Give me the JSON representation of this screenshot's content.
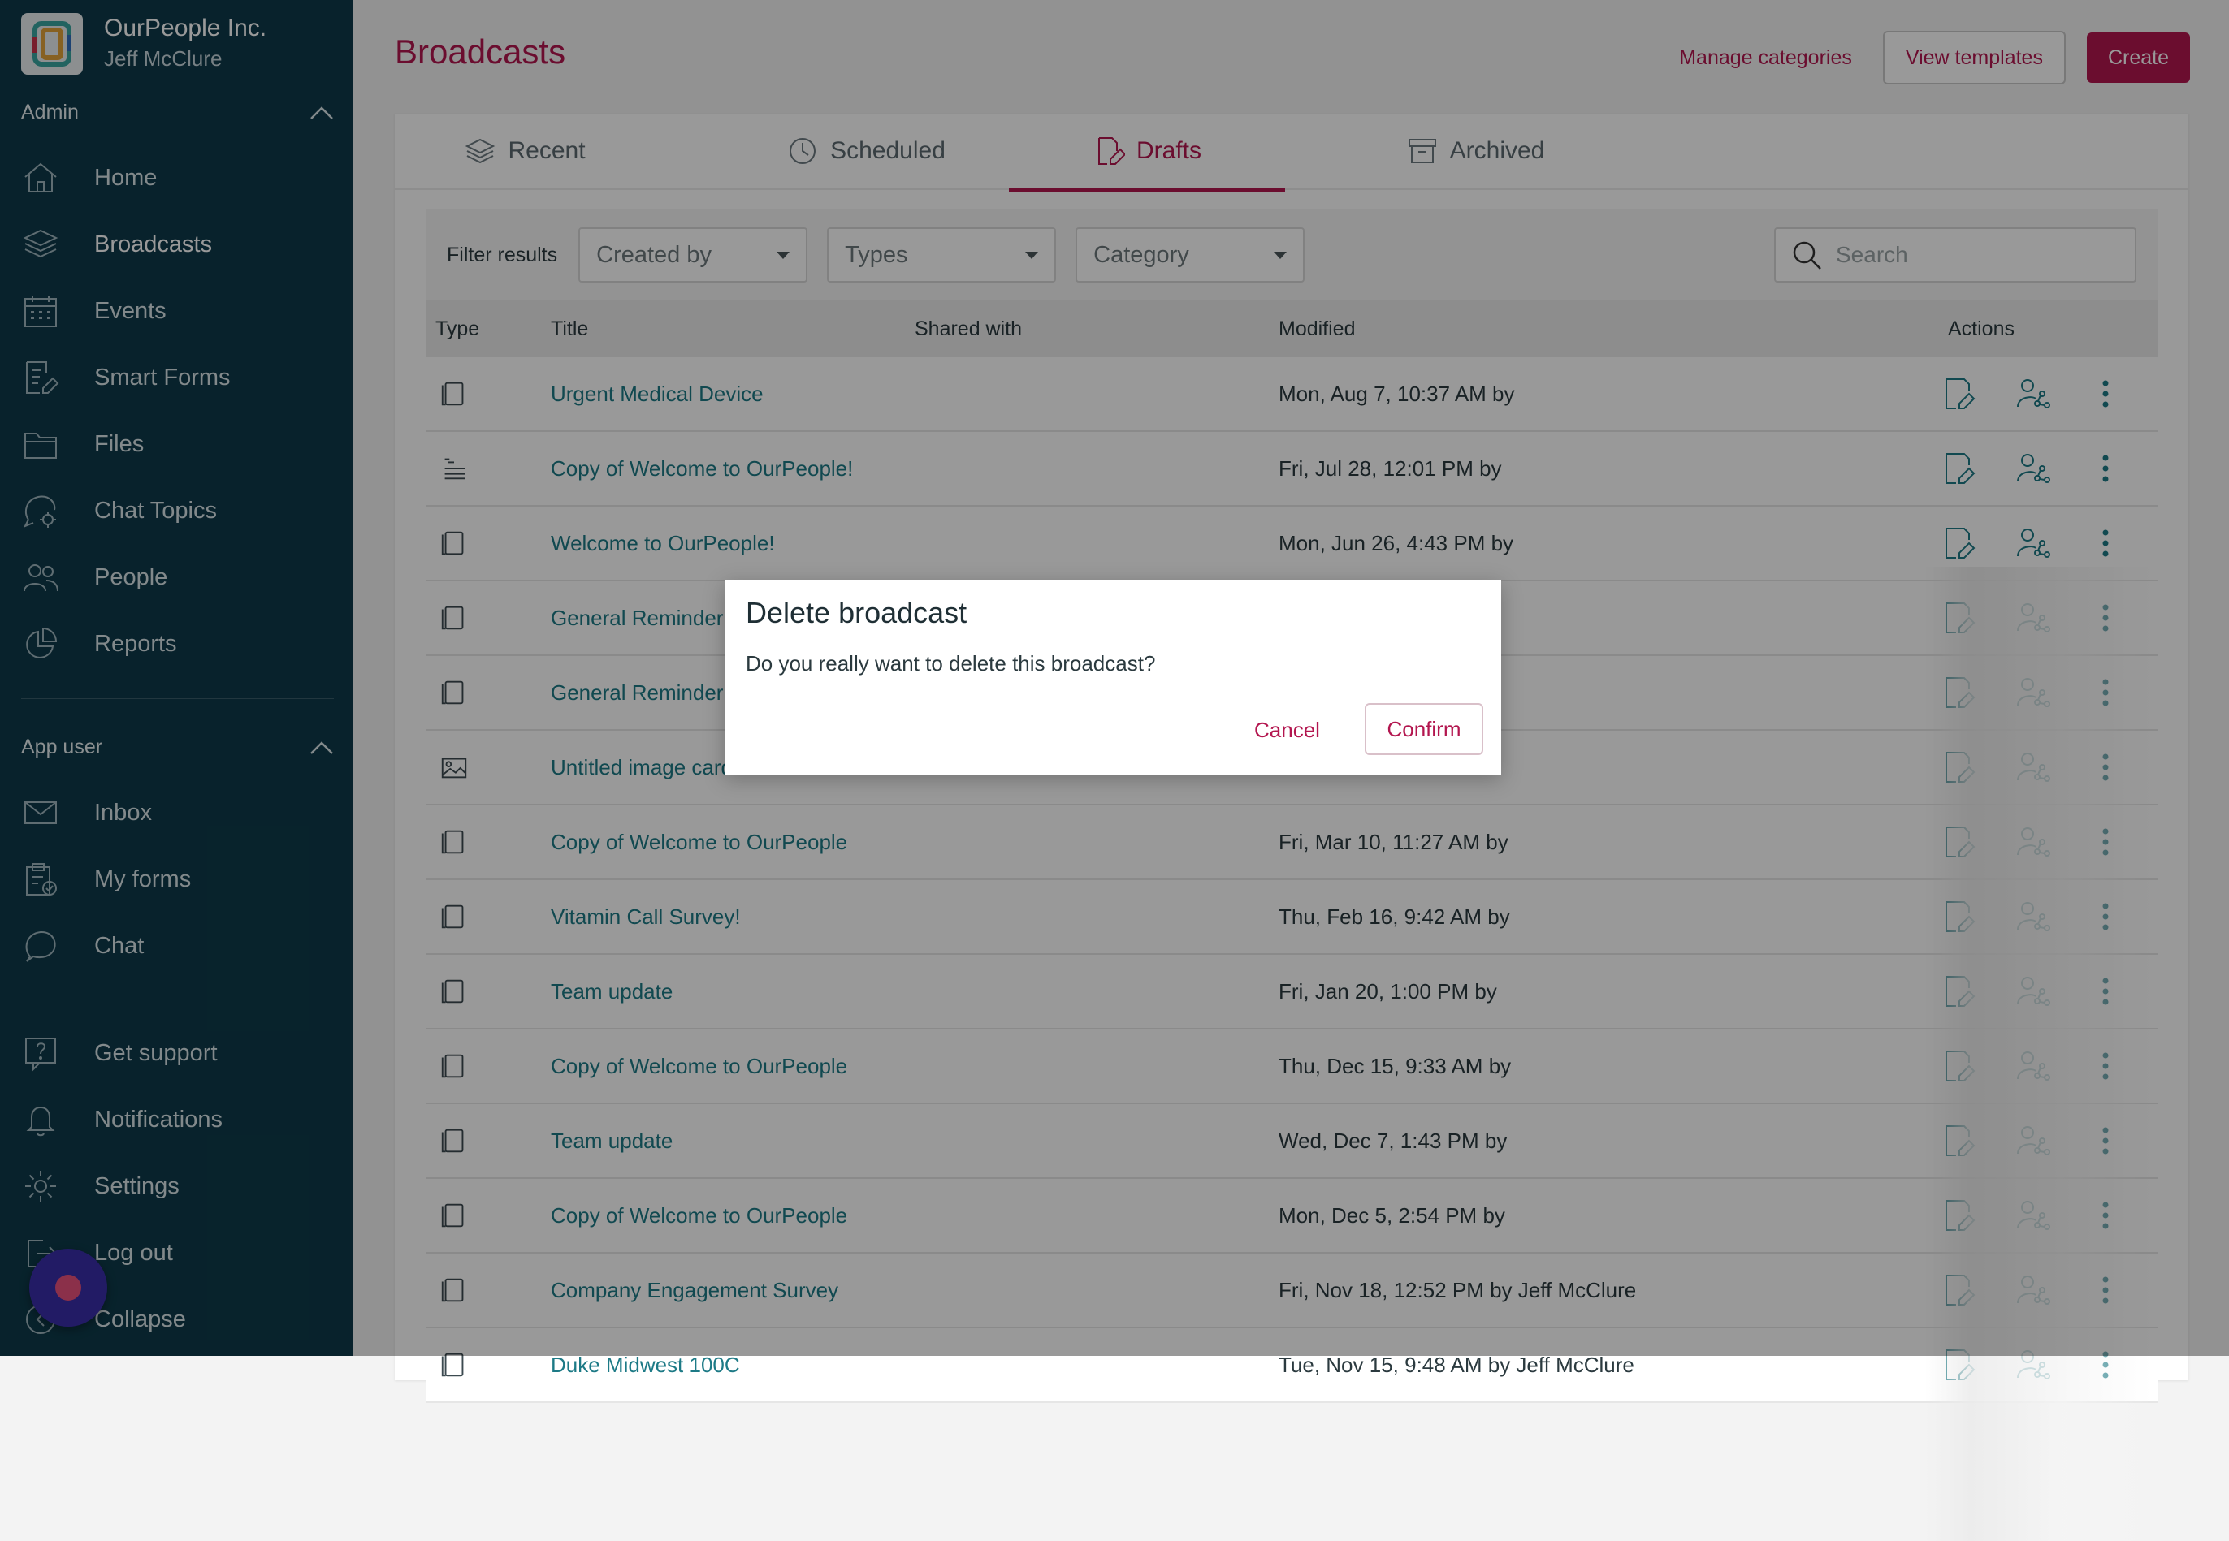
{
  "org": {
    "name": "OurPeople Inc.",
    "user": "Jeff McClure"
  },
  "sidebar": {
    "admin_label": "Admin",
    "admin_items": [
      {
        "label": "Home",
        "icon": "home-icon"
      },
      {
        "label": "Broadcasts",
        "icon": "layers-icon"
      },
      {
        "label": "Events",
        "icon": "calendar-icon"
      },
      {
        "label": "Smart Forms",
        "icon": "form-edit-icon"
      },
      {
        "label": "Files",
        "icon": "folder-icon"
      },
      {
        "label": "Chat Topics",
        "icon": "chat-gear-icon"
      },
      {
        "label": "People",
        "icon": "people-icon"
      },
      {
        "label": "Reports",
        "icon": "pie-chart-icon"
      }
    ],
    "app_user_label": "App user",
    "app_items": [
      {
        "label": "Inbox",
        "icon": "mail-icon"
      },
      {
        "label": "My forms",
        "icon": "clipboard-check-icon"
      },
      {
        "label": "Chat",
        "icon": "chat-bubble-icon"
      }
    ],
    "bottom_items": [
      {
        "label": "Get support",
        "icon": "help-icon"
      },
      {
        "label": "Notifications",
        "icon": "bell-icon"
      },
      {
        "label": "Settings",
        "icon": "gear-icon"
      },
      {
        "label": "Log out",
        "icon": "logout-icon"
      },
      {
        "label": "Collapse",
        "icon": "collapse-icon"
      }
    ]
  },
  "header": {
    "title": "Broadcasts",
    "manage_categories": "Manage categories",
    "view_templates": "View templates",
    "create": "Create"
  },
  "tabs": [
    {
      "label": "Recent",
      "icon": "layers-icon"
    },
    {
      "label": "Scheduled",
      "icon": "clock-icon"
    },
    {
      "label": "Drafts",
      "icon": "draft-edit-icon",
      "active": true
    },
    {
      "label": "Archived",
      "icon": "archive-icon"
    }
  ],
  "filters": {
    "label": "Filter results",
    "created_by": "Created by",
    "types": "Types",
    "category": "Category",
    "search_placeholder": "Search"
  },
  "table": {
    "columns": {
      "type": "Type",
      "title": "Title",
      "shared_with": "Shared with",
      "modified": "Modified",
      "actions": "Actions"
    },
    "rows": [
      {
        "type": "card-icon",
        "title": "Urgent Medical Device",
        "modified": "Mon, Aug 7, 10:37 AM by"
      },
      {
        "type": "list-icon",
        "title": "Copy of Welcome to OurPeople!",
        "modified": "Fri, Jul 28, 12:01 PM by"
      },
      {
        "type": "card-icon",
        "title": "Welcome to OurPeople!",
        "modified": "Mon, Jun 26, 4:43 PM by"
      },
      {
        "type": "card-icon",
        "title": "General Reminder!",
        "modified": ""
      },
      {
        "type": "card-icon",
        "title": "General Reminder!",
        "modified": ""
      },
      {
        "type": "image-icon",
        "title": "Untitled image card",
        "modified": ""
      },
      {
        "type": "card-icon",
        "title": "Copy of Welcome to OurPeople",
        "modified": "Fri, Mar 10, 11:27 AM by"
      },
      {
        "type": "card-icon",
        "title": "Vitamin Call Survey!",
        "modified": "Thu, Feb 16, 9:42 AM by"
      },
      {
        "type": "card-icon",
        "title": "Team update",
        "modified": "Fri, Jan 20, 1:00 PM by"
      },
      {
        "type": "card-icon",
        "title": "Copy of Welcome to OurPeople",
        "modified": "Thu, Dec 15, 9:33 AM by"
      },
      {
        "type": "card-icon",
        "title": "Team update",
        "modified": "Wed, Dec 7, 1:43 PM by"
      },
      {
        "type": "card-icon",
        "title": "Copy of Welcome to OurPeople",
        "modified": "Mon, Dec 5, 2:54 PM by"
      },
      {
        "type": "card-icon",
        "title": "Company Engagement Survey",
        "modified": "Fri, Nov 18, 12:52 PM by Jeff McClure"
      },
      {
        "type": "card-icon",
        "title": "Duke Midwest 100C",
        "modified": "Tue, Nov 15, 9:48 AM by Jeff McClure"
      }
    ]
  },
  "modal": {
    "title": "Delete broadcast",
    "text": "Do you really want to delete this broadcast?",
    "cancel": "Cancel",
    "confirm": "Confirm"
  },
  "colors": {
    "brand": "#b3164f",
    "sidebar": "#0e3a4a",
    "link": "#1d7a86"
  }
}
